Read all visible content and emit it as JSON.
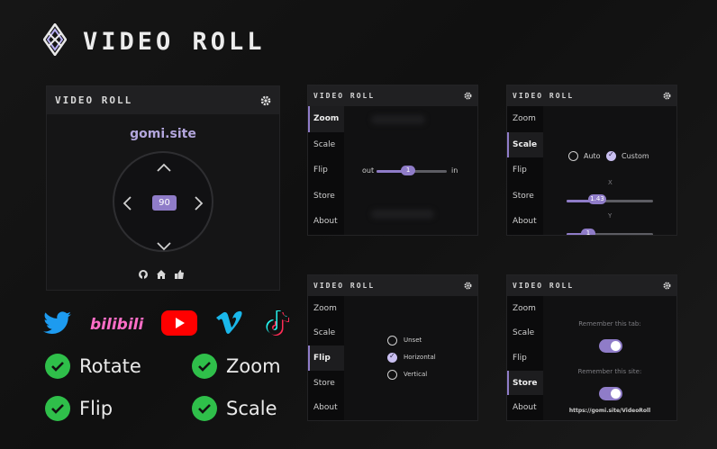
{
  "brand": {
    "title": "VIDEO ROLL"
  },
  "colors": {
    "accent": "#8f7cc8",
    "check": "#2fbf4a",
    "background": "#141414"
  },
  "main": {
    "title": "VIDEO ROLL",
    "site": "gomi.site",
    "value": "90",
    "icons": [
      "github-icon",
      "home-icon",
      "thumbs-up-icon"
    ]
  },
  "tabs": [
    "Zoom",
    "Scale",
    "Flip",
    "Store",
    "About"
  ],
  "zoom_panel": {
    "title": "VIDEO ROLL",
    "active": "Zoom",
    "out_label": "out",
    "in_label": "in",
    "value": "1",
    "level": 0.45
  },
  "scale_panel": {
    "title": "VIDEO ROLL",
    "active": "Scale",
    "auto_label": "Auto",
    "custom_label": "Custom",
    "x_label": "X",
    "x_value": "1.43",
    "y_label": "Y",
    "y_value": "1"
  },
  "flip_panel": {
    "title": "VIDEO ROLL",
    "active": "Flip",
    "options": [
      "Unset",
      "Horizontal",
      "Vertical"
    ],
    "selected": "Horizontal"
  },
  "store_panel": {
    "title": "VIDEO ROLL",
    "active": "Store",
    "remember_tab": "Remember this tab:",
    "remember_site": "Remember this site:",
    "url": "https://gomi.site/VideoRoll"
  },
  "social": [
    "twitter-icon",
    "bilibili-icon",
    "youtube-icon",
    "vimeo-icon",
    "tiktok-icon"
  ],
  "social_text": {
    "bilibili": "bilibili"
  },
  "features": [
    "Rotate",
    "Zoom",
    "Flip",
    "Scale"
  ]
}
